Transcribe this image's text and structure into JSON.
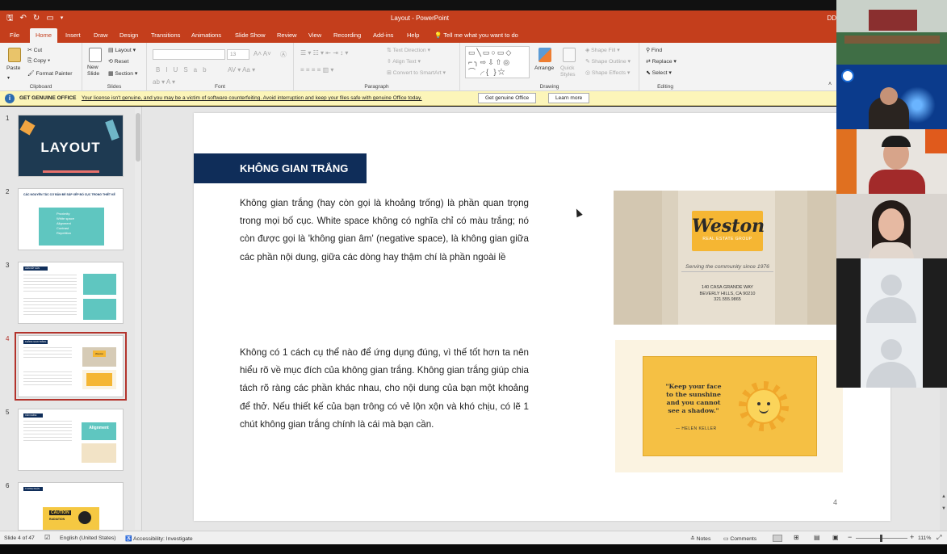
{
  "app": {
    "window_title": "Layout - PowerPoint",
    "user_initials": "DD"
  },
  "tabs": [
    "File",
    "Home",
    "Insert",
    "Draw",
    "Design",
    "Transitions",
    "Animations",
    "Slide Show",
    "Review",
    "View",
    "Recording",
    "Add-ins",
    "Help"
  ],
  "tell_me": "Tell me what you want to do",
  "ribbon": {
    "clipboard": {
      "paste": "Paste",
      "cut": "Cut",
      "copy": "Copy",
      "format_painter": "Format Painter",
      "label": "Clipboard"
    },
    "slides": {
      "new_slide": "New Slide",
      "layout": "Layout",
      "reset": "Reset",
      "section": "Section",
      "label": "Slides"
    },
    "font": {
      "size": "13",
      "label": "Font"
    },
    "paragraph": {
      "text_direction": "Text Direction",
      "align_text": "Align Text",
      "convert_smartart": "Convert to SmartArt",
      "label": "Paragraph"
    },
    "drawing": {
      "arrange": "Arrange",
      "quick_styles": "Quick Styles",
      "shape_fill": "Shape Fill",
      "shape_outline": "Shape Outline",
      "shape_effects": "Shape Effects",
      "label": "Drawing"
    },
    "editing": {
      "find": "Find",
      "replace": "Replace",
      "select": "Select",
      "label": "Editing"
    }
  },
  "message_bar": {
    "title": "GET GENUINE OFFICE",
    "text": "Your license isn't genuine, and you may be a victim of software counterfeiting. Avoid interruption and keep your files safe with genuine Office today.",
    "btn_genuine": "Get genuine Office",
    "btn_learn": "Learn more"
  },
  "thumbnails": [
    {
      "num": "1",
      "title": "LAYOUT"
    },
    {
      "num": "2",
      "title": "CÁC NGUYÊN TẮC CƠ BẢN ĐỂ SẮP XẾP BỐ CỤC TRONG THIẾT KẾ",
      "items": [
        "Proximity",
        "White space",
        "Alignment",
        "Contrast",
        "Repetition"
      ]
    },
    {
      "num": "3",
      "title": "LIÊN KẾT GẦN"
    },
    {
      "num": "4",
      "title": "KHÔNG GIAN TRẮNG",
      "badge": "Weston"
    },
    {
      "num": "5",
      "title": "CĂN CHỈNH",
      "badge": "Alignment"
    },
    {
      "num": "6",
      "title": "TƯƠNG PHẢN",
      "badge": "CAUTION",
      "badge2": "RADIATION"
    }
  ],
  "slide": {
    "heading": "KHÔNG GIAN TRẮNG",
    "para1": "Không gian trắng (hay còn gọi là khoảng trống) là phần quan trọng trong mọi bố cục. White space không có nghĩa chỉ có màu trắng; nó còn được gọi là 'không gian âm' (negative space), là không gian giữa các phần nội dung, giữa các dòng hay thậm chí là phần ngoài lề",
    "para2": "Không có 1 cách cụ thể nào để ứng dụng đúng, vì thế tốt hơn ta nên hiểu rõ về mục đích của không gian trắng. Không gian trắng giúp chia tách rõ ràng các phần khác nhau, cho nội dung của bạn một khoảng để thở. Nếu thiết kế của bạn trông có vẻ lộn xộn và khó chịu, có lẽ 1 chút không gian trắng chính là cái mà bạn cần.",
    "page_number": "4",
    "card1": {
      "brand": "Weston",
      "sub": "REAL ESTATE GROUP",
      "tagline": "Serving the community since 1976",
      "addr1": "140 CASA GRANDE WAY",
      "addr2": "BEVERLY HILLS, CA 90210",
      "phone": "321.555.9865"
    },
    "card2": {
      "quote": "\"Keep your face to the sunshine and you cannot see a shadow.\"",
      "author": "— HELEN KELLER"
    }
  },
  "status": {
    "slide_info": "Slide 4 of 47",
    "language": "English (United States)",
    "accessibility": "Accessibility: Investigate",
    "notes": "Notes",
    "comments": "Comments",
    "zoom": "111%"
  },
  "colors": {
    "accent": "#c43e1c",
    "heading_bar": "#0f2d59",
    "selected_thumb": "#b3332c"
  }
}
